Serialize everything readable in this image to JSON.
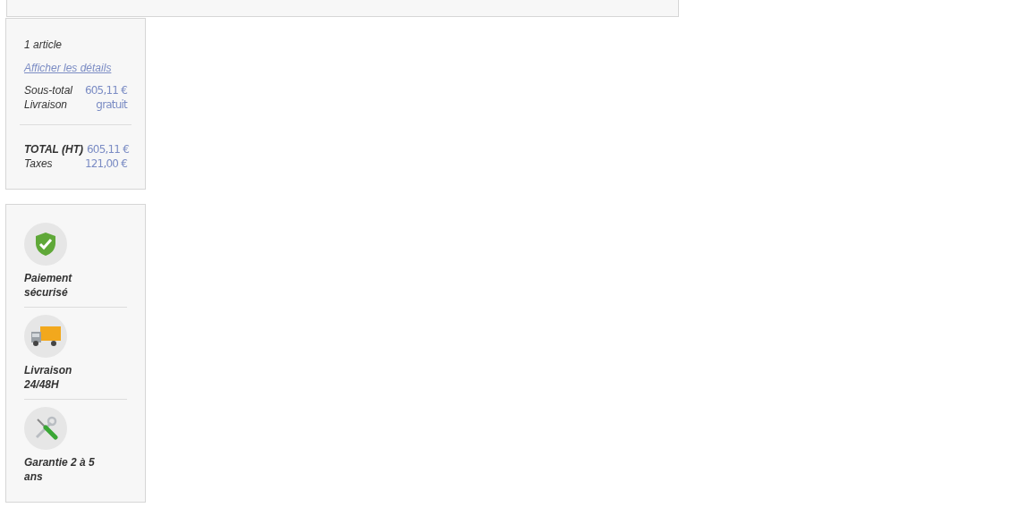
{
  "summary": {
    "count": "1 article",
    "details_link": "Afficher les détails",
    "lines": [
      {
        "label": "Sous-total",
        "value": "605,11 €"
      },
      {
        "label": "Livraison",
        "value": "gratuit"
      }
    ],
    "totals": [
      {
        "label": "TOTAL (HT)",
        "value": "605,11 €",
        "strong": true
      },
      {
        "label": "Taxes",
        "value": "121,00 €",
        "strong": false
      }
    ]
  },
  "features": [
    {
      "kind": "shield",
      "label": "Paiement sécurisé"
    },
    {
      "kind": "truck",
      "label": "Livraison 24/48H"
    },
    {
      "kind": "tools",
      "label": "Garantie 2 à 5 ans"
    }
  ]
}
